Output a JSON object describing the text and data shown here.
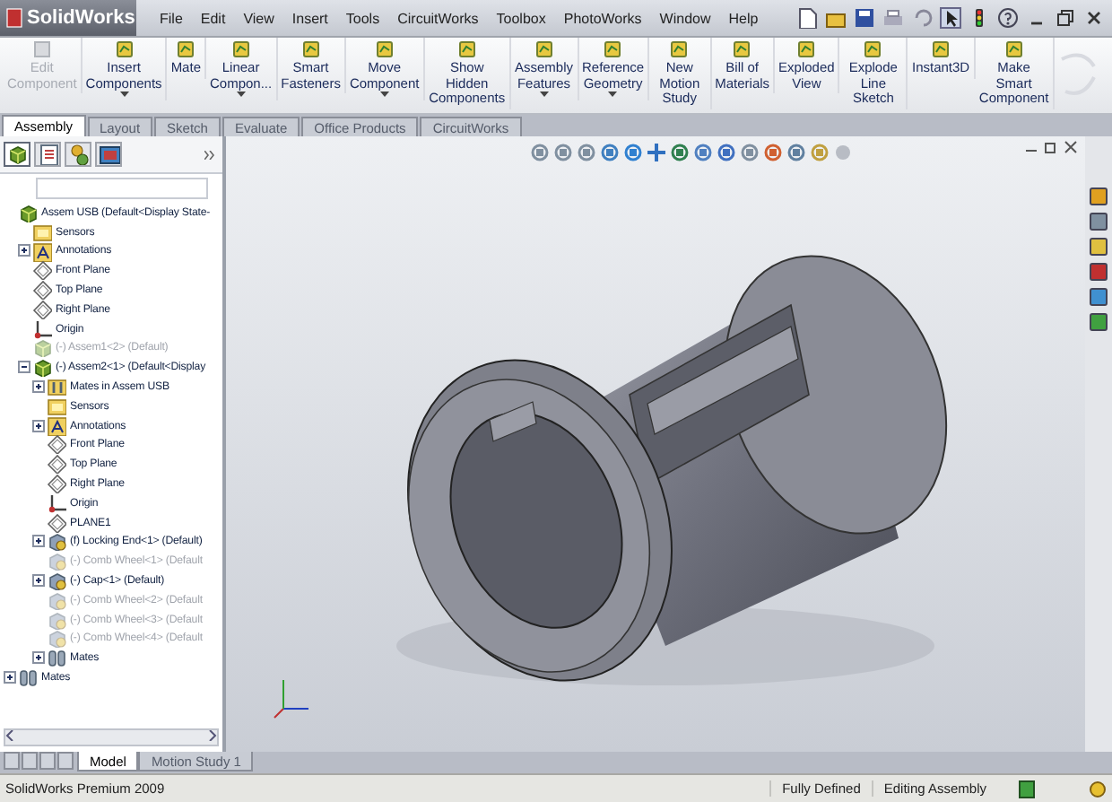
{
  "app": {
    "logo": "SolidWorks"
  },
  "menu": [
    "File",
    "Edit",
    "View",
    "Insert",
    "Tools",
    "CircuitWorks",
    "Toolbox",
    "PhotoWorks",
    "Window",
    "Help"
  ],
  "commands": [
    {
      "label": "Edit Component",
      "disabled": true,
      "menu": false
    },
    {
      "label": "Insert Components",
      "disabled": false,
      "menu": true
    },
    {
      "label": "Mate",
      "disabled": false,
      "menu": false
    },
    {
      "label": "Linear Compon...",
      "disabled": false,
      "menu": true
    },
    {
      "label": "Smart Fasteners",
      "disabled": false,
      "menu": false
    },
    {
      "label": "Move Component",
      "disabled": false,
      "menu": true
    },
    {
      "label": "Show Hidden Components",
      "disabled": false,
      "menu": false
    },
    {
      "label": "Assembly Features",
      "disabled": false,
      "menu": true
    },
    {
      "label": "Reference Geometry",
      "disabled": false,
      "menu": true
    },
    {
      "label": "New Motion Study",
      "disabled": false,
      "menu": false
    },
    {
      "label": "Bill of Materials",
      "disabled": false,
      "menu": false
    },
    {
      "label": "Exploded View",
      "disabled": false,
      "menu": false
    },
    {
      "label": "Explode Line Sketch",
      "disabled": false,
      "menu": false
    },
    {
      "label": "Instant3D",
      "disabled": false,
      "menu": false
    },
    {
      "label": "Make Smart Component",
      "disabled": false,
      "menu": false
    }
  ],
  "tabs": [
    {
      "label": "Assembly",
      "selected": true
    },
    {
      "label": "Layout",
      "selected": false
    },
    {
      "label": "Sketch",
      "selected": false
    },
    {
      "label": "Evaluate",
      "selected": false
    },
    {
      "label": "Office Products",
      "selected": false
    },
    {
      "label": "CircuitWorks",
      "selected": false
    }
  ],
  "panel_tabs": [
    {
      "kind": "assembly",
      "selected": true
    },
    {
      "kind": "properties",
      "selected": false
    },
    {
      "kind": "config",
      "selected": false
    },
    {
      "kind": "display",
      "selected": false
    }
  ],
  "tree": [
    {
      "label": "Assem USB  (Default<Display State-",
      "kind": "assembly",
      "dimmed": false,
      "children": [
        {
          "label": "Sensors",
          "kind": "sensor",
          "dimmed": false
        },
        {
          "label": "Annotations",
          "kind": "annotation",
          "dimmed": false,
          "expanded": false
        },
        {
          "label": "Front Plane",
          "kind": "plane",
          "dimmed": false
        },
        {
          "label": "Top Plane",
          "kind": "plane",
          "dimmed": false
        },
        {
          "label": "Right Plane",
          "kind": "plane",
          "dimmed": false
        },
        {
          "label": "Origin",
          "kind": "origin",
          "dimmed": false
        },
        {
          "label": "(-) Assem1<2> (Default)",
          "kind": "assembly",
          "dimmed": true
        },
        {
          "label": "(-) Assem2<1> (Default<Display",
          "kind": "assembly",
          "dimmed": false,
          "expanded": true,
          "children": [
            {
              "label": "Mates in Assem USB",
              "kind": "mates",
              "dimmed": false,
              "expanded": false
            },
            {
              "label": "Sensors",
              "kind": "sensor",
              "dimmed": false
            },
            {
              "label": "Annotations",
              "kind": "annotation",
              "dimmed": false,
              "expanded": false
            },
            {
              "label": "Front Plane",
              "kind": "plane",
              "dimmed": false
            },
            {
              "label": "Top Plane",
              "kind": "plane",
              "dimmed": false
            },
            {
              "label": "Right Plane",
              "kind": "plane",
              "dimmed": false
            },
            {
              "label": "Origin",
              "kind": "origin",
              "dimmed": false
            },
            {
              "label": "PLANE1",
              "kind": "plane",
              "dimmed": false
            },
            {
              "label": "(f) Locking End<1> (Default)",
              "kind": "part",
              "dimmed": false,
              "expanded": false
            },
            {
              "label": "(-) Comb Wheel<1> (Default",
              "kind": "part",
              "dimmed": true
            },
            {
              "label": "(-) Cap<1> (Default)",
              "kind": "part",
              "dimmed": false,
              "expanded": false
            },
            {
              "label": "(-) Comb Wheel<2> (Default",
              "kind": "part",
              "dimmed": true
            },
            {
              "label": "(-) Comb Wheel<3> (Default",
              "kind": "part",
              "dimmed": true
            },
            {
              "label": "(-) Comb Wheel<4> (Default",
              "kind": "part",
              "dimmed": true
            },
            {
              "label": "Mates",
              "kind": "matefolder",
              "dimmed": false,
              "expanded": false
            }
          ]
        }
      ]
    },
    {
      "label": "Mates",
      "kind": "matefolder",
      "dimmed": false,
      "expanded": false
    }
  ],
  "bottom_tabs": [
    {
      "label": "Model",
      "selected": true
    },
    {
      "label": "Motion Study 1",
      "selected": false
    }
  ],
  "status_bar": {
    "product": "SolidWorks Premium 2009",
    "state": "Fully Defined",
    "mode": "Editing Assembly"
  }
}
